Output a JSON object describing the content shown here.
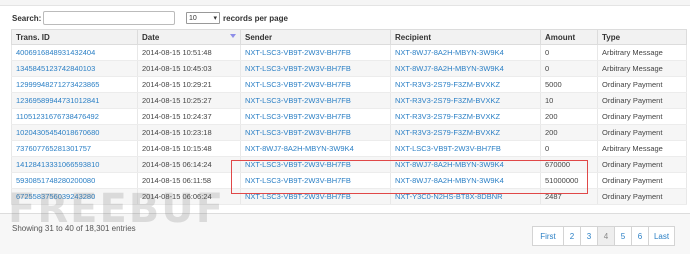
{
  "search": {
    "label": "Search:",
    "value": ""
  },
  "length": {
    "selected": "10",
    "label": "records per page"
  },
  "table": {
    "headers": [
      "Trans. ID",
      "Date",
      "Sender",
      "Recipient",
      "Amount",
      "Type"
    ],
    "rows": [
      [
        "4006916848931432404",
        "2014-08-15 10:51:48",
        "NXT-LSC3-VB9T-2W3V-BH7FB",
        "NXT-8WJ7-8A2H-MBYN-3W9K4",
        "0",
        "Arbitrary Message"
      ],
      [
        "1345845123742840103",
        "2014-08-15 10:45:03",
        "NXT-LSC3-VB9T-2W3V-BH7FB",
        "NXT-8WJ7-8A2H-MBYN-3W9K4",
        "0",
        "Arbitrary Message"
      ],
      [
        "12999948271273423865",
        "2014-08-15 10:29:21",
        "NXT-LSC3-VB9T-2W3V-BH7FB",
        "NXT-R3V3-2S79-F3ZM-BVXKZ",
        "5000",
        "Ordinary Payment"
      ],
      [
        "12369589944731012841",
        "2014-08-15 10:25:27",
        "NXT-LSC3-VB9T-2W3V-BH7FB",
        "NXT-R3V3-2S79-F3ZM-BVXKZ",
        "10",
        "Ordinary Payment"
      ],
      [
        "11051231676738476492",
        "2014-08-15 10:24:37",
        "NXT-LSC3-VB9T-2W3V-BH7FB",
        "NXT-R3V3-2S79-F3ZM-BVXKZ",
        "200",
        "Ordinary Payment"
      ],
      [
        "10204305454018670680",
        "2014-08-15 10:23:18",
        "NXT-LSC3-VB9T-2W3V-BH7FB",
        "NXT-R3V3-2S79-F3ZM-BVXKZ",
        "200",
        "Ordinary Payment"
      ],
      [
        "737607765281301757",
        "2014-08-15 10:15:48",
        "NXT-8WJ7-8A2H-MBYN-3W9K4",
        "NXT-LSC3-VB9T-2W3V-BH7FB",
        "0",
        "Arbitrary Message"
      ],
      [
        "14128413331066593810",
        "2014-08-15 06:14:24",
        "NXT-LSC3-VB9T-2W3V-BH7FB",
        "NXT-8WJ7-8A2H-MBYN-3W9K4",
        "670000",
        "Ordinary Payment"
      ],
      [
        "5930851748280200080",
        "2014-08-15 06:11:58",
        "NXT-LSC3-VB9T-2W3V-BH7FB",
        "NXT-8WJ7-8A2H-MBYN-3W9K4",
        "51000000",
        "Ordinary Payment"
      ],
      [
        "6725583756039243280",
        "2014-08-15 06:06:24",
        "NXT-LSC3-VB9T-2W3V-BH7FB",
        "NXT-Y3C0-N2HS-BT8X-8DBNR",
        "2487",
        "Ordinary Payment"
      ]
    ]
  },
  "info": "Showing 31 to 40 of 18,301 entries",
  "pagination": {
    "buttons": [
      "First",
      "2",
      "3",
      "4",
      "5",
      "6",
      "Last"
    ],
    "active": "4"
  },
  "watermark": "FREEBUF",
  "colors": {
    "link": "#2a7fc5",
    "highlight_border": "#e04848"
  }
}
